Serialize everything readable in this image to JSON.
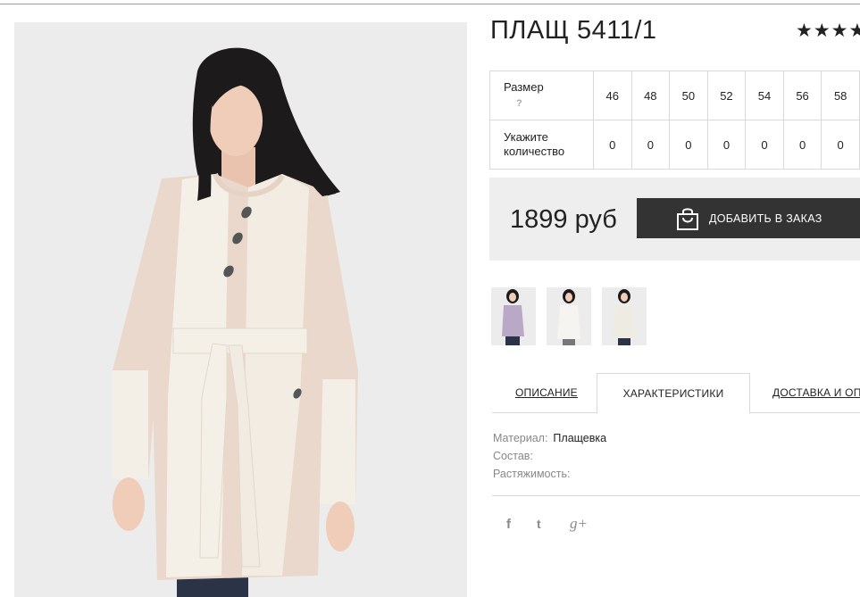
{
  "product": {
    "title": "ПЛАЩ 5411/1",
    "rating_stars": "★★★★"
  },
  "sizes": {
    "size_label": "Размер",
    "help_mark": "?",
    "qty_label_line1": "Укажите",
    "qty_label_line2": "количество",
    "values": [
      "46",
      "48",
      "50",
      "52",
      "54",
      "56",
      "58"
    ],
    "quantities": [
      "0",
      "0",
      "0",
      "0",
      "0",
      "0",
      "0"
    ]
  },
  "purchase": {
    "price": "1899 руб",
    "add_button_label": "ДОБАВИТЬ В ЗАКАЗ"
  },
  "tabs": {
    "description": "ОПИСАНИЕ",
    "characteristics": "ХАРАКТЕРИСТИКИ",
    "delivery": "ДОСТАВКА И ОПЛАТА"
  },
  "specs": {
    "material_label": "Материал:",
    "material_value": "Плащевка",
    "composition_label": "Состав:",
    "stretch_label": "Растяжимость:"
  },
  "social": {
    "facebook": "f",
    "twitter": "t",
    "googleplus": "g+"
  },
  "icons": {
    "bag": "shopping-bag-icon",
    "star": "star-icon"
  },
  "colors": {
    "button_bg": "#333333",
    "price_box_bg": "#eeeeee",
    "coat_beige": "#ead8cc",
    "coat_cream": "#f4f0e8"
  }
}
